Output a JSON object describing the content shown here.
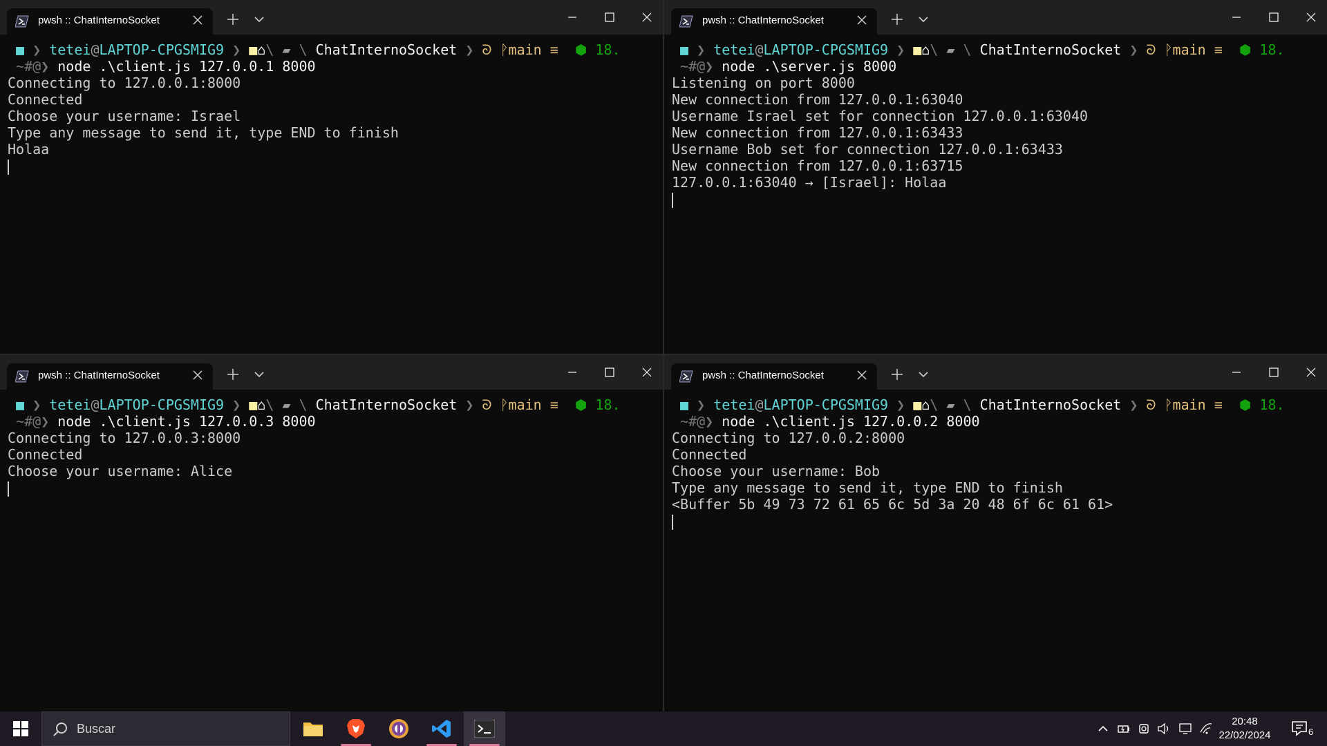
{
  "windows": [
    {
      "id": "tl",
      "tab_title": "pwsh :: ChatInternoSocket",
      "prompt": {
        "user": "tetei",
        "at": "@",
        "host": "LAPTOP-CPGSMIG9",
        "folder": "ChatInternoSocket",
        "branch": "main",
        "branch_status": "≡",
        "node_version": "18."
      },
      "input_prefix": "~#@",
      "command": "node .\\client.js 127.0.0.1 8000",
      "output": [
        "Connecting to 127.0.0.1:8000",
        "Connected",
        "Choose your username: Israel",
        "Type any message to send it, type END to finish",
        "Holaa"
      ]
    },
    {
      "id": "tr",
      "tab_title": "pwsh :: ChatInternoSocket",
      "prompt": {
        "user": "tetei",
        "at": "@",
        "host": "LAPTOP-CPGSMIG9",
        "folder": "ChatInternoSocket",
        "branch": "main",
        "branch_status": "≡",
        "node_version": "18."
      },
      "input_prefix": "~#@",
      "command": "node .\\server.js 8000",
      "output": [
        "Listening on port 8000",
        "New connection from 127.0.0.1:63040",
        "Username Israel set for connection 127.0.0.1:63040",
        "New connection from 127.0.0.1:63433",
        "Username Bob set for connection 127.0.0.1:63433",
        "New connection from 127.0.0.1:63715",
        "127.0.0.1:63040 → [Israel]: Holaa"
      ]
    },
    {
      "id": "bl",
      "tab_title": "pwsh :: ChatInternoSocket",
      "prompt": {
        "user": "tetei",
        "at": "@",
        "host": "LAPTOP-CPGSMIG9",
        "folder": "ChatInternoSocket",
        "branch": "main",
        "branch_status": "≡",
        "node_version": "18."
      },
      "input_prefix": "~#@",
      "command": "node .\\client.js 127.0.0.3 8000",
      "output": [
        "Connecting to 127.0.0.3:8000",
        "Connected",
        "Choose your username: Alice"
      ]
    },
    {
      "id": "br",
      "tab_title": "pwsh :: ChatInternoSocket",
      "prompt": {
        "user": "tetei",
        "at": "@",
        "host": "LAPTOP-CPGSMIG9",
        "folder": "ChatInternoSocket",
        "branch": "main",
        "branch_status": "≡",
        "node_version": "18."
      },
      "input_prefix": "~#@",
      "command": "node .\\client.js 127.0.0.2 8000",
      "output": [
        "Connecting to 127.0.0.2:8000",
        "Connected",
        "Choose your username: Bob",
        "Type any message to send it, type END to finish",
        "<Buffer 5b 49 73 72 61 65 6c 5d 3a 20 48 6f 6c 61 61>"
      ]
    }
  ],
  "taskbar": {
    "search_placeholder": "Buscar",
    "apps": [
      "file-explorer",
      "brave-browser",
      "tor-browser",
      "vscode",
      "windows-terminal"
    ],
    "time": "20:48",
    "date": "22/02/2024",
    "notification_count": "6"
  }
}
